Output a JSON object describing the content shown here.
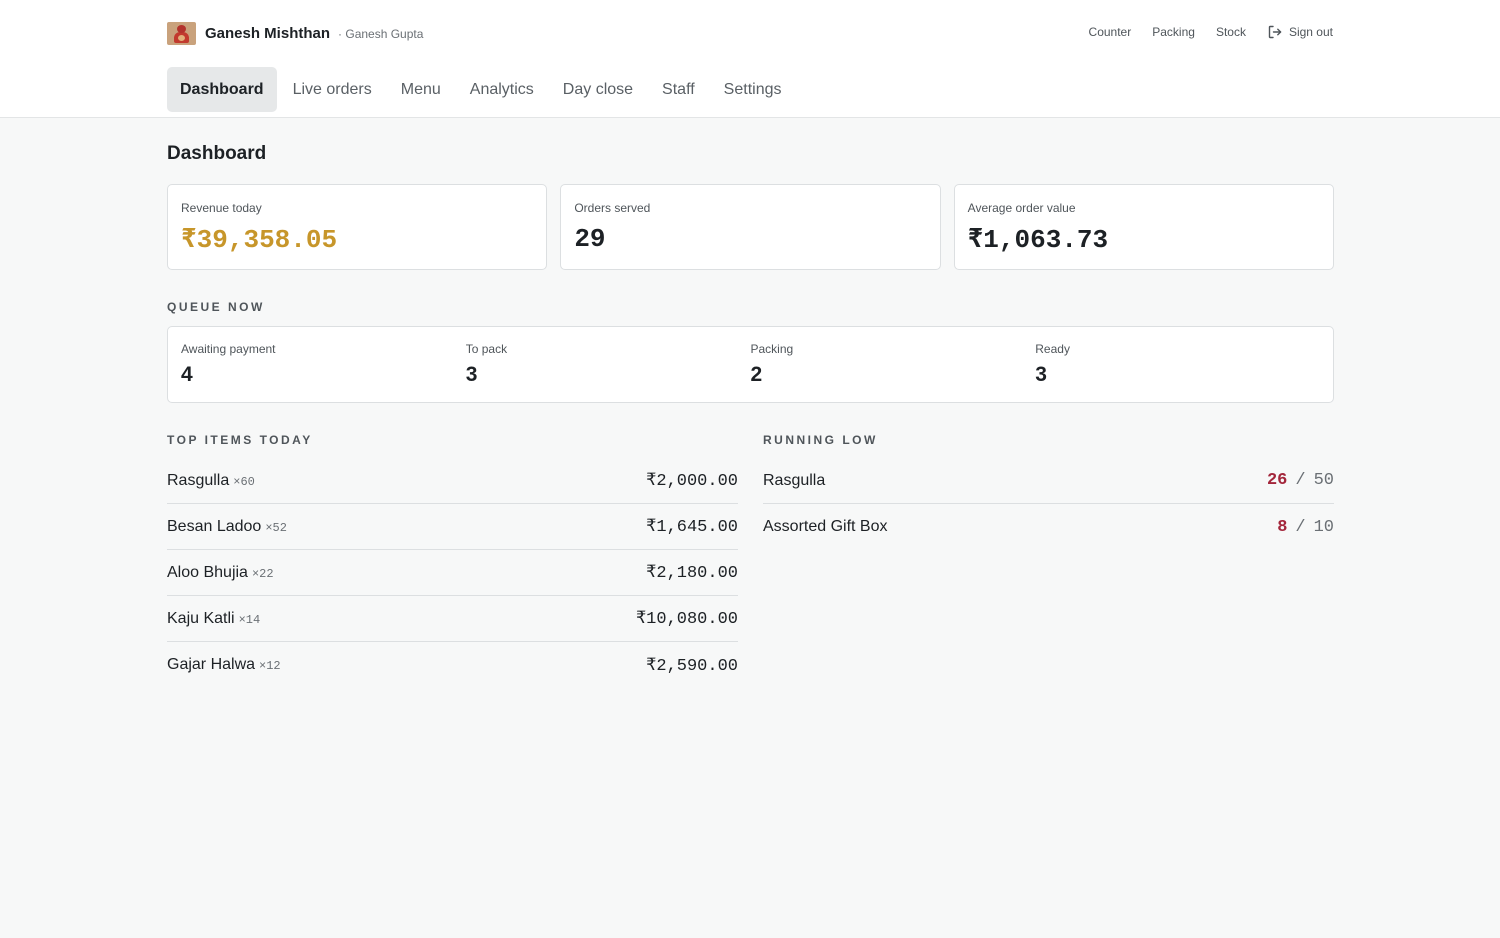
{
  "brand": {
    "name": "Ganesh Mishthan",
    "user": "· Ganesh Gupta",
    "logo_icon": "ganesh-logo-icon"
  },
  "top_nav": {
    "counter": "Counter",
    "packing": "Packing",
    "stock": "Stock",
    "sign_out": "Sign out"
  },
  "tabs": [
    {
      "label": "Dashboard",
      "active": true
    },
    {
      "label": "Live orders"
    },
    {
      "label": "Menu"
    },
    {
      "label": "Analytics"
    },
    {
      "label": "Day close"
    },
    {
      "label": "Staff"
    },
    {
      "label": "Settings"
    }
  ],
  "page_title": "Dashboard",
  "kpis": [
    {
      "label": "Revenue today",
      "value": "₹39,358.05"
    },
    {
      "label": "Orders served",
      "value": "29"
    },
    {
      "label": "Average order value",
      "value": "₹1,063.73"
    }
  ],
  "queue": {
    "title": "QUEUE NOW",
    "cells": [
      {
        "label": "Awaiting payment",
        "value": "4"
      },
      {
        "label": "To pack",
        "value": "3"
      },
      {
        "label": "Packing",
        "value": "2"
      },
      {
        "label": "Ready",
        "value": "3"
      }
    ]
  },
  "top_items": {
    "title": "TOP ITEMS TODAY",
    "rows": [
      {
        "name": "Rasgulla",
        "qty": "×60",
        "amount": "₹2,000.00"
      },
      {
        "name": "Besan Ladoo",
        "qty": "×52",
        "amount": "₹1,645.00"
      },
      {
        "name": "Aloo Bhujia",
        "qty": "×22",
        "amount": "₹2,180.00"
      },
      {
        "name": "Kaju Katli",
        "qty": "×14",
        "amount": "₹10,080.00"
      },
      {
        "name": "Gajar Halwa",
        "qty": "×12",
        "amount": "₹2,590.00"
      }
    ]
  },
  "running_low": {
    "title": "RUNNING LOW",
    "separator": "/",
    "rows": [
      {
        "name": "Rasgulla",
        "current": "26",
        "max": "50"
      },
      {
        "name": "Assorted Gift Box",
        "current": "8",
        "max": "10"
      }
    ]
  },
  "colors": {
    "accent_revenue": "#c7962a",
    "low_stock": "#a3263b",
    "active_tab_bg": "#e6e8e9",
    "page_bg": "#f7f8f8"
  }
}
